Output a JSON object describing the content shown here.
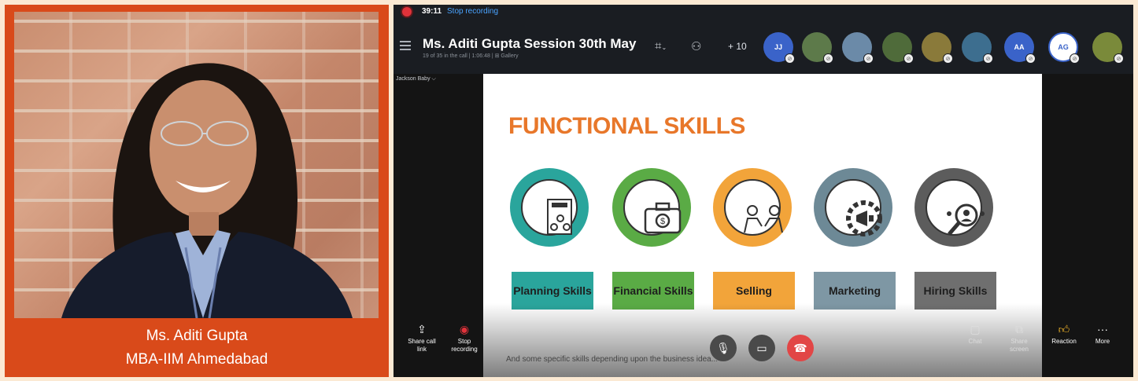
{
  "speaker": {
    "name": "Ms. Aditi Gupta",
    "degree": "MBA-IIM Ahmedabad"
  },
  "call": {
    "recording_time": "39:11",
    "stop_recording_link": "Stop recording",
    "title": "Ms. Aditi Gupta Session 30th May",
    "subtitle": "19 of 35 in the call | 1:06:48 | ⊞ Gallery",
    "more_participants": "+ 10",
    "active_view_label": "Jackson Baby ⌵",
    "participants": [
      {
        "initials": "JJ",
        "color": "#3a63c9"
      },
      {
        "initials": "",
        "color": "#5d7a4a"
      },
      {
        "initials": "",
        "color": "#6b8aa8"
      },
      {
        "initials": "",
        "color": "#4f6b3a"
      },
      {
        "initials": "",
        "color": "#8a7a3a"
      },
      {
        "initials": "",
        "color": "#3d6e8f"
      },
      {
        "initials": "AA",
        "color": "#3a63c9"
      },
      {
        "initials": "AG",
        "color": "#3a63c9"
      },
      {
        "initials": "",
        "color": "#7a8a3a"
      }
    ]
  },
  "slide": {
    "title": "FUNCTIONAL SKILLS",
    "skills": [
      {
        "label": "Planning Skills",
        "circle_color": "#2aa59c",
        "box_color": "#2aa59c",
        "icon": "plan-document-icon"
      },
      {
        "label": "Financial Skills",
        "circle_color": "#5aab45",
        "box_color": "#5aab45",
        "icon": "briefcase-dollar-icon"
      },
      {
        "label": "Selling",
        "circle_color": "#f2a43a",
        "box_color": "#f2a43a",
        "icon": "handshake-deal-icon"
      },
      {
        "label": "Marketing",
        "circle_color": "#6d8996",
        "box_color": "#7e97a4",
        "icon": "megaphone-gear-icon"
      },
      {
        "label": "Hiring Skills",
        "circle_color": "#5c5c5c",
        "box_color": "#6f6f6f",
        "icon": "magnifier-people-icon"
      }
    ]
  },
  "caption_text": "And  some specific skills depending upon the business idea...",
  "controls": {
    "share_call_link": "Share call link",
    "stop_recording": "Stop recording",
    "chat": "Chat",
    "share_screen": "Share screen",
    "reaction": "Reaction",
    "more": "More"
  }
}
